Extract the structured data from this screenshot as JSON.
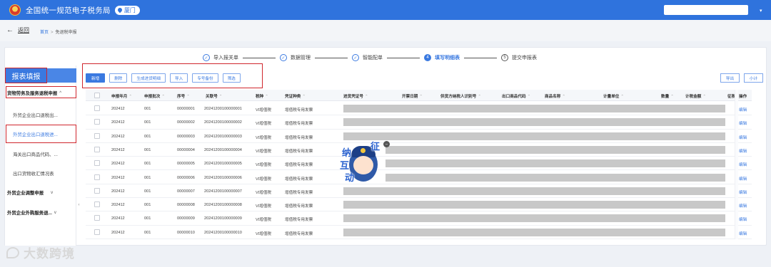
{
  "header": {
    "app_title": "全国统一规范电子税务局",
    "city": "厦门",
    "emblem_icon": "national-emblem-icon",
    "brand_color": "#2f73dd"
  },
  "breadcrumb": {
    "back_label": "返回",
    "home": "首页",
    "current": "免退税申报"
  },
  "steps": [
    {
      "num": "✓",
      "label": "导入报关单",
      "state": "done"
    },
    {
      "num": "✓",
      "label": "数据管理",
      "state": "done"
    },
    {
      "num": "✓",
      "label": "智能配单",
      "state": "done"
    },
    {
      "num": "4",
      "label": "填写明细表",
      "state": "active"
    },
    {
      "num": "5",
      "label": "提交申报表",
      "state": "pending"
    }
  ],
  "sidebar": {
    "title": "报表填报",
    "groups": [
      {
        "label": "货物劳务及服务退税申报",
        "items": [
          "外贸企业出口退税出...",
          "外贸企业出口退税进...",
          "海关出口商品代码、...",
          "出口货物收汇情况表"
        ]
      },
      {
        "label": "外贸企业调整申报",
        "items": []
      },
      {
        "label": "外贸企业外购服务退...",
        "items": []
      }
    ],
    "active_item": 1
  },
  "toolbar": {
    "buttons": [
      "新增",
      "删除",
      "生成进货明细",
      "导入",
      "专号备份",
      "筛选"
    ],
    "right_buttons": [
      "导出",
      "小计"
    ]
  },
  "table": {
    "columns": [
      "申报年月",
      "申报批次",
      "序号",
      "关联号",
      "税种",
      "凭证种类",
      "进货凭证号",
      "开票日期",
      "供货方纳税人识别号",
      "出口商品代码",
      "商品名称",
      "计量单位",
      "数量",
      "计税金额",
      "征税",
      "操作"
    ],
    "rows": [
      {
        "ym": "202412",
        "batch": "001",
        "seq": "00000001",
        "rel": "20241200100000001",
        "tax": "VI增值税",
        "voucher": "增值税专用发票",
        "op": "编辑"
      },
      {
        "ym": "202412",
        "batch": "001",
        "seq": "00000002",
        "rel": "20241200100000002",
        "tax": "VI增值税",
        "voucher": "增值税专用发票",
        "op": "编辑"
      },
      {
        "ym": "202412",
        "batch": "001",
        "seq": "00000003",
        "rel": "20241200100000003",
        "tax": "VI增值税",
        "voucher": "增值税专用发票",
        "op": "编辑"
      },
      {
        "ym": "202412",
        "batch": "001",
        "seq": "00000004",
        "rel": "20241200100000004",
        "tax": "VI增值税",
        "voucher": "增值税专用发票",
        "op": "编辑"
      },
      {
        "ym": "202412",
        "batch": "001",
        "seq": "00000005",
        "rel": "20241200100000005",
        "tax": "VI增值税",
        "voucher": "增值税专用发票",
        "op": "编辑"
      },
      {
        "ym": "202412",
        "batch": "001",
        "seq": "00000006",
        "rel": "20241200100000006",
        "tax": "VI增值税",
        "voucher": "增值税专用发票",
        "op": "编辑"
      },
      {
        "ym": "202412",
        "batch": "001",
        "seq": "00000007",
        "rel": "20241200100000007",
        "tax": "VI增值税",
        "voucher": "增值税专用发票",
        "op": "编辑"
      },
      {
        "ym": "202412",
        "batch": "001",
        "seq": "00000008",
        "rel": "20241200100000008",
        "tax": "VI增值税",
        "voucher": "增值税专用发票",
        "op": "编辑"
      },
      {
        "ym": "202412",
        "batch": "001",
        "seq": "00000009",
        "rel": "20241200100000009",
        "tax": "VI增值税",
        "voucher": "增值税专用发票",
        "op": "编辑"
      },
      {
        "ym": "202412",
        "batch": "001",
        "seq": "00000010",
        "rel": "20241200100000010",
        "tax": "VI增值税",
        "voucher": "增值税专用发票",
        "op": "编辑"
      }
    ]
  },
  "mascot": {
    "chars": [
      "征",
      "纳",
      "互",
      "动"
    ]
  },
  "watermark": "大数跨境"
}
